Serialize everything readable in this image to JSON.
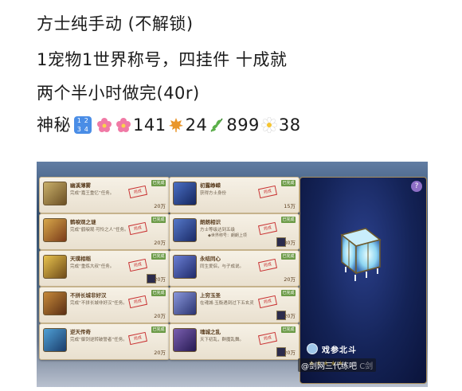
{
  "post": {
    "line1": "方士纯手动 (不解锁)",
    "line2": "1宠物1世界称号，四挂件 十成就",
    "line3": "两个半小时做完(40r)",
    "line4_prefix": "神秘",
    "keycap_digits": [
      "1",
      "2",
      "3",
      "4"
    ],
    "count_flower": "141",
    "count_leaf": "24",
    "count_herb": "899",
    "count_blossom": "38"
  },
  "achievements": {
    "left": [
      {
        "name": "幽溪薄雾",
        "desc": "完成“嘉王重忆”任务。",
        "points": "20"
      },
      {
        "name": "鹤唳观之谜",
        "desc": "完成“鹤唳观·可怜之人”任务。",
        "points": "20"
      },
      {
        "name": "天璞相稻",
        "desc": "完成“重炼大叔”任务。",
        "points": "20"
      },
      {
        "name": "不拼长城非好汉",
        "desc": "完成“不拼长城非好汉”任务。",
        "points": "20"
      },
      {
        "name": "逆天传奇",
        "desc": "完成“御剑逆转破誓者”任务。",
        "points": "20"
      }
    ],
    "right": [
      {
        "name": "初露峥嵘",
        "desc": "获得方士身份",
        "points": "15"
      },
      {
        "name": "朗朗相识",
        "desc": "方士等级达到五级",
        "sub": "◆世界称号：朗朗上项",
        "points": "30"
      },
      {
        "name": "永结同心",
        "desc": "同生爱侣，与子成说。",
        "points": "20"
      },
      {
        "name": "上穷玉圣",
        "desc": "在魂城·玉衡遇到过下五玄灵",
        "points": "20"
      },
      {
        "name": "魂城之乱",
        "desc": "天下初乱，群魔乱舞。",
        "points": "20"
      }
    ],
    "completed_tag": "已完成",
    "stamp_text": "完成",
    "points_suffix": "万"
  },
  "detail_panel": {
    "help_icon": "?",
    "title": "戏参北斗",
    "stars": "★★★★★"
  },
  "watermark": {
    "text": "@剑网三代练吧",
    "ghost": "C剑"
  },
  "colors": {
    "keycap_blue": "#4a8de6",
    "completed_green": "#6c9b47",
    "stamp_red": "#c93333",
    "panel_blue": "#142357"
  },
  "icons": [
    "keycap-1234-icon",
    "cherry-blossom-icon",
    "cherry-blossom-icon",
    "maple-leaf-icon",
    "herb-icon",
    "blossom-icon",
    "lantern-icon",
    "help-icon"
  ]
}
